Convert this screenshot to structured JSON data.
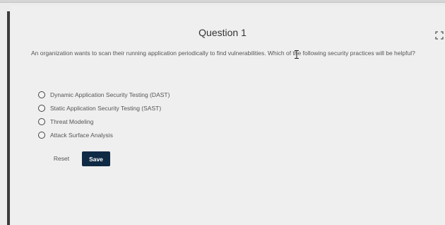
{
  "question": {
    "title": "Question 1",
    "prompt": "An organization wants to scan their running application periodically to find vulnerabilities. Which of the following security practices will be helpful?",
    "options": [
      {
        "label": "Dynamic Application Security Testing (DAST)"
      },
      {
        "label": "Static Application Security Testing (SAST)"
      },
      {
        "label": "Threat Modeling"
      },
      {
        "label": "Attack Surface Analysis"
      }
    ]
  },
  "actions": {
    "reset_label": "Reset",
    "save_label": "Save"
  },
  "icons": {
    "expand": "expand-icon",
    "text_cursor": "text-cursor-icon"
  },
  "colors": {
    "save_button": "#0f2a44",
    "background": "#ececec"
  }
}
